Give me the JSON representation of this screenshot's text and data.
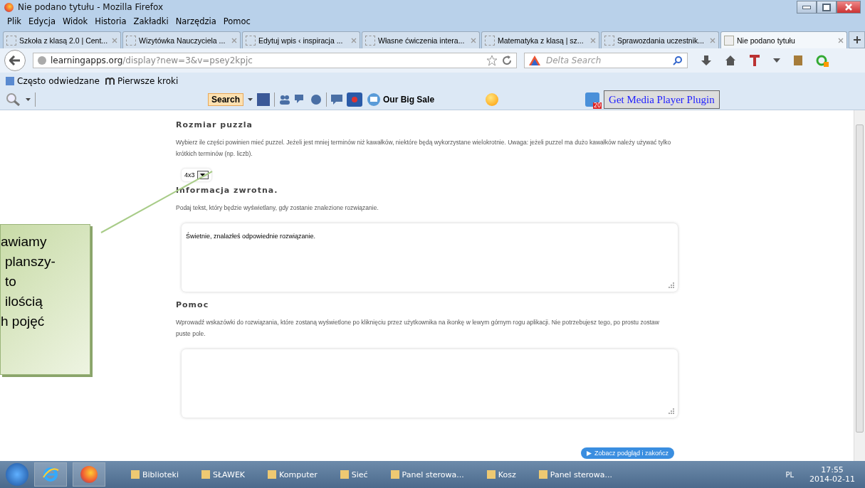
{
  "window": {
    "title": "Nie podano tytułu - Mozilla Firefox"
  },
  "menu": [
    "Plik",
    "Edycja",
    "Widok",
    "Historia",
    "Zakładki",
    "Narzędzia",
    "Pomoc"
  ],
  "tabs": [
    {
      "label": "Szkoła z klasą 2.0 | Cent...",
      "selected": false
    },
    {
      "label": "Wizytówka Nauczyciela ...",
      "selected": false
    },
    {
      "label": "Edytuj wpis ‹ inspiracja ...",
      "selected": false
    },
    {
      "label": "Własne ćwiczenia intera...",
      "selected": false
    },
    {
      "label": "Matematyka z klasą | sz...",
      "selected": false
    },
    {
      "label": "Sprawozdania uczestnik...",
      "selected": false
    },
    {
      "label": "Nie podano tytułu",
      "selected": true
    }
  ],
  "address": {
    "domain": "learningapps.org",
    "path": "/display?new=3&v=psey2kpjc"
  },
  "search": {
    "placeholder": "Delta Search"
  },
  "bookmarks": [
    "Często odwiedzane",
    "Pierwsze kroki"
  ],
  "toolbar": {
    "search_button": "Search",
    "sale": "Our Big Sale",
    "plugin_button": "Get Media Player Plugin",
    "badge": "20"
  },
  "sections": [
    {
      "title": "Rozmiar puzzla",
      "description": "Wybierz ile części powinien mieć puzzel. Jeżeli jest mniej terminów niż kawałków, niektóre będą wykorzystane wielokrotnie. Uwaga: jeżeli puzzel ma dużo kawałków należy używać tylko krótkich terminów (np. liczb).",
      "kind": "select",
      "value": "4x3"
    },
    {
      "title": "Informacja zwrotna.",
      "description": "Podaj tekst, który będzie wyświetlany, gdy zostanie znalezione rozwiązanie.",
      "kind": "textarea",
      "value": "Świetnie, znalazłeś odpowiednie rozwiązanie."
    },
    {
      "title": "Pomoc",
      "description": "Wprowadź wskazówki do rozwiązania, które zostaną wyświetlone po kliknięciu przez użytkownika na ikonkę w lewym górnym rogu aplikacji. Nie potrzebujesz tego, po prostu zostaw puste pole.",
      "kind": "textarea"
    }
  ],
  "preview_button": "Zobacz podgląd i zakończ",
  "callout": [
    "awiamy",
    "planszy-",
    "to",
    "ilością",
    "h pojęć"
  ],
  "taskbar": {
    "items": [
      "Biblioteki",
      "SŁAWEK",
      "Komputer",
      "Sieć",
      "Panel sterowa...",
      "Kosz",
      "Panel sterowa..."
    ],
    "language": "PL",
    "time": "17:55",
    "date": "2014-02-11"
  }
}
